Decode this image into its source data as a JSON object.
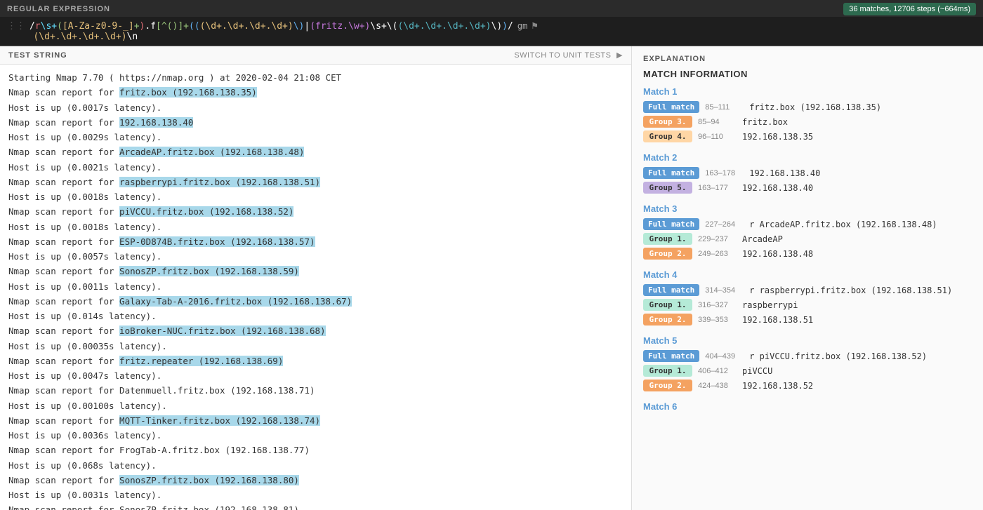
{
  "regex_header": {
    "label": "REGULAR EXPRESSION",
    "badge": "36 matches, 12706 steps (~664ms)",
    "pattern_display": "r\\s+([A-Za-z0-9-_]+).f[^()]+((\\d+.\\d+.\\d+.\\d+)\\)|(fritz.\\w+)\\s+\\((\\d+.\\d+.\\d+.\\d+)\\)\\)(\\d+.\\d+.\\d+.\\d+)\\n",
    "flags": "gm",
    "flags_icon": "⚑"
  },
  "test_string": {
    "label": "TEST STRING",
    "switch_label": "SWITCH TO UNIT TESTS"
  },
  "explanation": {
    "label": "EXPLANATION",
    "match_info_label": "MATCH INFORMATION"
  },
  "matches": [
    {
      "title": "Match 1",
      "rows": [
        {
          "badge_type": "full",
          "badge_label": "Full match",
          "range": "85–111",
          "value": "fritz.box (192.168.138.35)"
        },
        {
          "badge_type": "g3",
          "badge_label": "Group 3.",
          "range": "85–94",
          "value": "fritz.box"
        },
        {
          "badge_type": "g4",
          "badge_label": "Group 4.",
          "range": "96–110",
          "value": "192.168.138.35"
        }
      ]
    },
    {
      "title": "Match 2",
      "rows": [
        {
          "badge_type": "full",
          "badge_label": "Full match",
          "range": "163–178",
          "value": "192.168.138.40"
        },
        {
          "badge_type": "g5",
          "badge_label": "Group 5.",
          "range": "163–177",
          "value": "192.168.138.40"
        }
      ]
    },
    {
      "title": "Match 3",
      "rows": [
        {
          "badge_type": "full",
          "badge_label": "Full match",
          "range": "227–264",
          "value": "r ArcadeAP.fritz.box (192.168.138.48)"
        },
        {
          "badge_type": "g1",
          "badge_label": "Group 1.",
          "range": "229–237",
          "value": "ArcadeAP"
        },
        {
          "badge_type": "g2",
          "badge_label": "Group 2.",
          "range": "249–263",
          "value": "192.168.138.48"
        }
      ]
    },
    {
      "title": "Match 4",
      "rows": [
        {
          "badge_type": "full",
          "badge_label": "Full match",
          "range": "314–354",
          "value": "r raspberrypi.fritz.box (192.168.138.51)"
        },
        {
          "badge_type": "g1",
          "badge_label": "Group 1.",
          "range": "316–327",
          "value": "raspberrypi"
        },
        {
          "badge_type": "g2",
          "badge_label": "Group 2.",
          "range": "339–353",
          "value": "192.168.138.51"
        }
      ]
    },
    {
      "title": "Match 5",
      "rows": [
        {
          "badge_type": "full",
          "badge_label": "Full match",
          "range": "404–439",
          "value": "r piVCCU.fritz.box (192.168.138.52)"
        },
        {
          "badge_type": "g1",
          "badge_label": "Group 1.",
          "range": "406–412",
          "value": "piVCCU"
        },
        {
          "badge_type": "g2",
          "badge_label": "Group 2.",
          "range": "424–438",
          "value": "192.168.138.52"
        }
      ]
    },
    {
      "title": "Match 6",
      "rows": []
    }
  ]
}
